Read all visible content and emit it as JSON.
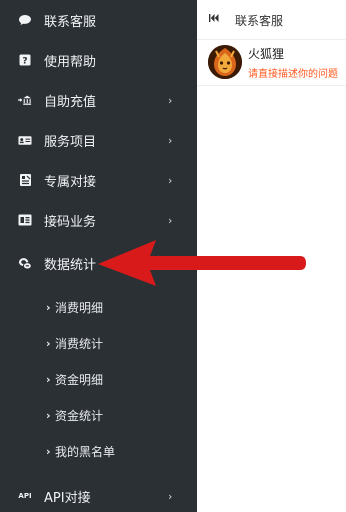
{
  "sidebar": {
    "items": [
      {
        "label": "联系客服",
        "icon": "chat-bubble-icon"
      },
      {
        "label": "使用帮助",
        "icon": "help-icon"
      },
      {
        "label": "自助充值",
        "icon": "bank-icon",
        "chevron": "›"
      },
      {
        "label": "服务项目",
        "icon": "id-card-icon",
        "chevron": "›"
      },
      {
        "label": "专属对接",
        "icon": "sheet-icon",
        "chevron": "›"
      },
      {
        "label": "接码业务",
        "icon": "code-icon",
        "chevron": "›"
      },
      {
        "label": "数据统计",
        "icon": "coins-icon"
      },
      {
        "label": "API对接",
        "icon": "api-icon",
        "chevron": "›"
      }
    ],
    "subitems": [
      {
        "label": "消费明细"
      },
      {
        "label": "消费统计"
      },
      {
        "label": "资金明细"
      },
      {
        "label": "资金统计"
      },
      {
        "label": "我的黑名单"
      }
    ],
    "api_badge": "API"
  },
  "chat": {
    "tab_label": "联系客服",
    "contact_name": "火狐狸",
    "contact_message": "请直接描述你的问题"
  },
  "colors": {
    "sidebar_bg": "#2b3035",
    "highlight_arrow": "#d81a1a",
    "message_text": "#ff5a1f"
  }
}
